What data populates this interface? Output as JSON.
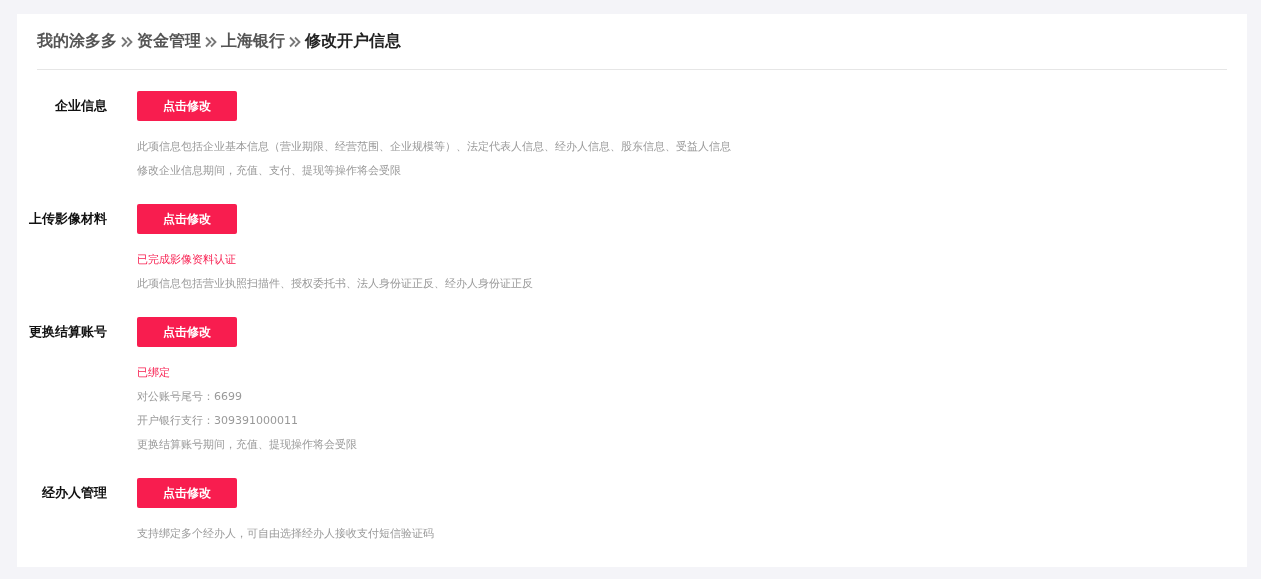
{
  "breadcrumb": [
    {
      "label": "我的涂多多",
      "selected": false
    },
    {
      "label": "资金管理",
      "selected": false
    },
    {
      "label": "上海银行",
      "selected": false
    },
    {
      "label": "修改开户信息",
      "selected": true
    }
  ],
  "sections": [
    {
      "label": "企业信息",
      "button": "点击修改",
      "notes": [
        {
          "kind": "info",
          "text": "此项信息包括企业基本信息（营业期限、经营范围、企业规模等）、法定代表人信息、经办人信息、股东信息、受益人信息"
        },
        {
          "kind": "info",
          "text": "修改企业信息期间，充值、支付、提现等操作将会受限"
        }
      ]
    },
    {
      "label": "上传影像材料",
      "button": "点击修改",
      "notes": [
        {
          "kind": "status",
          "text": "已完成影像资料认证"
        },
        {
          "kind": "info",
          "text": "此项信息包括营业执照扫描件、授权委托书、法人身份证正反、经办人身份证正反"
        }
      ]
    },
    {
      "label": "更换结算账号",
      "button": "点击修改",
      "notes": [
        {
          "kind": "status",
          "text": "已绑定"
        },
        {
          "kind": "info",
          "text": "对公账号尾号：6699"
        },
        {
          "kind": "info",
          "text": "开户银行支行：309391000011"
        },
        {
          "kind": "info",
          "text": "更换结算账号期间，充值、提现操作将会受限"
        }
      ]
    },
    {
      "label": "经办人管理",
      "button": "点击修改",
      "notes": [
        {
          "kind": "info",
          "text": "支持绑定多个经办人，可自由选择经办人接收支付短信验证码"
        }
      ]
    }
  ]
}
